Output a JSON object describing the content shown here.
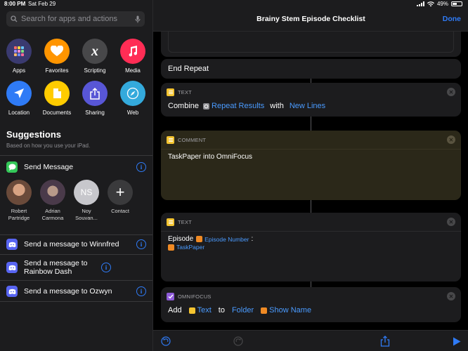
{
  "status": {
    "time": "8:00 PM",
    "date": "Sat Feb 29",
    "battery": "49%",
    "battery_level": 0.49
  },
  "sidebar": {
    "search_placeholder": "Search for apps and actions",
    "categories": [
      {
        "label": "Apps",
        "icon": "apps-grid-icon",
        "color": "#3a3a70"
      },
      {
        "label": "Favorites",
        "icon": "heart-icon",
        "color": "#ff9500"
      },
      {
        "label": "Scripting",
        "icon": "scripting-x-icon",
        "color": "#48484a"
      },
      {
        "label": "Media",
        "icon": "music-note-icon",
        "color": "#ff2d55"
      },
      {
        "label": "Location",
        "icon": "location-arrow-icon",
        "color": "#2f7bf6"
      },
      {
        "label": "Documents",
        "icon": "document-icon",
        "color": "#ffcc00"
      },
      {
        "label": "Sharing",
        "icon": "share-icon",
        "color": "#5856d6"
      },
      {
        "label": "Web",
        "icon": "compass-icon",
        "color": "#34aadc"
      }
    ],
    "suggestions_title": "Suggestions",
    "suggestions_subtitle": "Based on how you use your iPad.",
    "send_message": "Send Message",
    "contacts": [
      {
        "name": "Robert Partridge",
        "initials": ""
      },
      {
        "name": "Adrian Carmona",
        "initials": ""
      },
      {
        "name": "Noy Souvan...",
        "initials": "NS"
      },
      {
        "name": "Contact",
        "initials": "+"
      }
    ],
    "discord_rows": [
      {
        "label": "Send a message to Winnfred"
      },
      {
        "label": "Send a message to Rainbow Dash"
      },
      {
        "label": "Send a message to Ozwyn"
      }
    ]
  },
  "main": {
    "title": "Brainy Stem Episode Checklist",
    "done": "Done",
    "end_repeat": "End Repeat",
    "text_card1": {
      "label": "TEXT",
      "word1": "Combine",
      "var1": "Repeat Results",
      "word2": "with",
      "var2": "New Lines"
    },
    "comment_card": {
      "label": "COMMENT",
      "text": "TaskPaper into OmniFocus"
    },
    "text_card2": {
      "label": "TEXT",
      "prefix": "Episode",
      "var1": "Episode Number",
      "colon": ":",
      "var2": "TaskPaper"
    },
    "omnifocus_card": {
      "label": "OMNIFOCUS",
      "word1": "Add",
      "var1": "Text",
      "word2": "to",
      "var2": "Folder",
      "var3": "Show Name"
    }
  },
  "colors": {
    "accent": "#2f7bf6",
    "variable": "#4a9bff",
    "comment_bg": "#2b2819",
    "text_badge": "#f4c430",
    "omnifocus_badge": "#8e5bd8",
    "discord": "#5865f2",
    "messages": "#34c759"
  }
}
